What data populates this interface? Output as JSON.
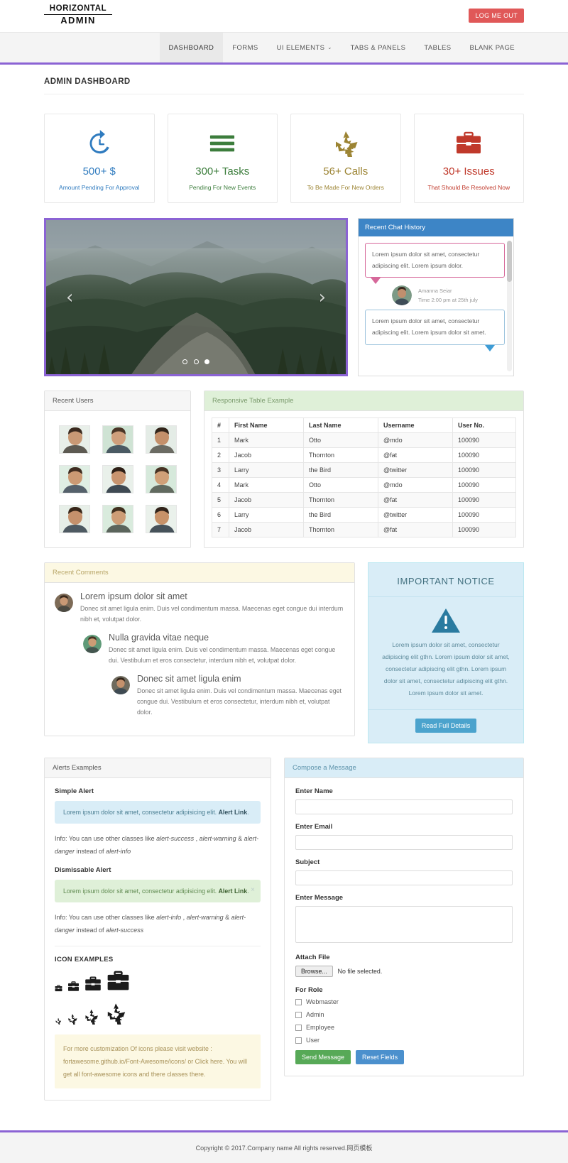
{
  "brand": {
    "line1": "HORIZONTAL",
    "line2": "ADMIN"
  },
  "header": {
    "logout_label": "LOG ME OUT"
  },
  "nav": {
    "items": [
      {
        "label": "DASHBOARD",
        "active": true
      },
      {
        "label": "FORMS",
        "active": false
      },
      {
        "label": "UI ELEMENTS",
        "active": false,
        "caret": "⌄"
      },
      {
        "label": "TABS & PANELS",
        "active": false
      },
      {
        "label": "TABLES",
        "active": false
      },
      {
        "label": "BLANK PAGE",
        "active": false
      }
    ]
  },
  "page": {
    "title": "ADMIN DASHBOARD"
  },
  "stats": [
    {
      "icon": "history-undo-icon",
      "number": "500+  $",
      "sub": "Amount Pending For Approval",
      "color": "#2f7bbf"
    },
    {
      "icon": "tasks-bars-icon",
      "number": "300+ Tasks",
      "sub": "Pending For New Events",
      "color": "#3c7d3c"
    },
    {
      "icon": "recycle-icon",
      "number": "56+ Calls",
      "sub": "To Be Made For New Orders",
      "color": "#9c8433"
    },
    {
      "icon": "briefcase-icon",
      "number": "30+ Issues",
      "sub": "That Should Be Resolved Now",
      "color": "#c0392b"
    }
  ],
  "carousel": {
    "prev_label": "‹",
    "next_label": "›",
    "slide_count": 3,
    "active_slide": 3
  },
  "chat": {
    "title": "Recent Chat History",
    "messages": [
      {
        "text": "Lorem ipsum dolor sit amet, consectetur adipiscing elit. Lorem ipsum dolor.",
        "side": "left"
      },
      {
        "text": "Lorem ipsum dolor sit amet, consectetur adipiscing elit. Lorem ipsum dolor sit amet.",
        "side": "right"
      }
    ],
    "meta": {
      "name": "Amanna Seiar",
      "time": "Time 2:00 pm at 25th july"
    }
  },
  "recent_users": {
    "title": "Recent Users",
    "count": 9
  },
  "table": {
    "title": "Responsive Table Example",
    "columns": [
      "#",
      "First Name",
      "Last Name",
      "Username",
      "User No."
    ],
    "rows": [
      [
        "1",
        "Mark",
        "Otto",
        "@mdo",
        "100090"
      ],
      [
        "2",
        "Jacob",
        "Thornton",
        "@fat",
        "100090"
      ],
      [
        "3",
        "Larry",
        "the Bird",
        "@twitter",
        "100090"
      ],
      [
        "4",
        "Mark",
        "Otto",
        "@mdo",
        "100090"
      ],
      [
        "5",
        "Jacob",
        "Thornton",
        "@fat",
        "100090"
      ],
      [
        "6",
        "Larry",
        "the Bird",
        "@twitter",
        "100090"
      ],
      [
        "7",
        "Jacob",
        "Thornton",
        "@fat",
        "100090"
      ]
    ]
  },
  "comments": {
    "title": "Recent Comments",
    "items": [
      {
        "heading": "Lorem ipsum dolor sit amet",
        "body": "Donec sit amet ligula enim. Duis vel condimentum massa. Maecenas eget congue dui interdum nibh et, volutpat dolor.",
        "indent": 0
      },
      {
        "heading": "Nulla gravida vitae neque",
        "body": "Donec sit amet ligula enim. Duis vel condimentum massa. Maecenas eget congue dui. Vestibulum et eros consectetur, interdum nibh et, volutpat dolor.",
        "indent": 1
      },
      {
        "heading": "Donec sit amet ligula enim",
        "body": "Donec sit amet ligula enim. Duis vel condimentum massa. Maecenas eget congue dui. Vestibulum et eros consectetur, interdum nibh et, volutpat dolor.",
        "indent": 2
      }
    ]
  },
  "notice": {
    "title": "IMPORTANT NOTICE",
    "icon": "warning-triangle-icon",
    "body": "Lorem ipsum dolor sit amet, consectetur adipiscing elit gthn. Lorem ipsum dolor sit amet, consectetur adipiscing elit gthn. Lorem ipsum dolor sit amet, consectetur adipiscing elit gthn. Lorem ipsum dolor sit amet.",
    "button_label": "Read Full Details"
  },
  "alerts": {
    "title": "Alerts Examples",
    "simple_title": "Simple Alert",
    "simple_text": "Lorem ipsum dolor sit amet, consectetur adipisicing elit. ",
    "simple_link": "Alert Link",
    "simple_tail": ".",
    "simple_note_a": "Info: You can use other classes like ",
    "simple_note_i1": "alert-success",
    "simple_note_b": " , ",
    "simple_note_i2": "alert-warning",
    "simple_note_c": " & ",
    "simple_note_i3": "alert-danger",
    "simple_note_d": " instead of ",
    "simple_note_i4": "alert-info",
    "dismiss_title": "Dismissable Alert",
    "dismiss_text": "Lorem ipsum dolor sit amet, consectetur adipisicing elit. ",
    "dismiss_link": "Alert Link",
    "dismiss_tail": ".",
    "dismiss_close": "×",
    "dismiss_note_a": "Info: You can use other classes like ",
    "dismiss_note_i1": "alert-info",
    "dismiss_note_b": " , ",
    "dismiss_note_i2": "alert-warning",
    "dismiss_note_c": " & ",
    "dismiss_note_i3": "alert-danger",
    "dismiss_note_d": " instead of ",
    "dismiss_note_i4": "alert-success",
    "icon_examples_title": "ICON EXAMPLES",
    "briefcase_sizes": [
      11,
      16,
      22,
      30
    ],
    "recycle_sizes": [
      9,
      14,
      20,
      28
    ],
    "tip": "For more customization Of icons please visit website : fortawesome.github.io/Font-Awesome/icons/ or Click here. You will get all font-awesome icons and there classes there."
  },
  "compose": {
    "title": "Compose a Message",
    "name_label": "Enter Name",
    "name_value": "",
    "email_label": "Enter Email",
    "email_value": "",
    "subject_label": "Subject",
    "subject_value": "",
    "message_label": "Enter Message",
    "message_value": "",
    "attach_label": "Attach File",
    "browse_label": "Browse...",
    "no_file_label": "No file selected.",
    "role_label": "For Role",
    "roles": [
      "Webmaster",
      "Admin",
      "Employee",
      "User"
    ],
    "send_label": "Send Message",
    "reset_label": "Reset Fields"
  },
  "footer": {
    "copyright": "Copyright © 2017.Company name All rights reserved.网页模板"
  },
  "colors": {
    "accent": "#8b63d4",
    "danger": "#e05858",
    "info": "#3d85c6",
    "success": "#57a957"
  }
}
